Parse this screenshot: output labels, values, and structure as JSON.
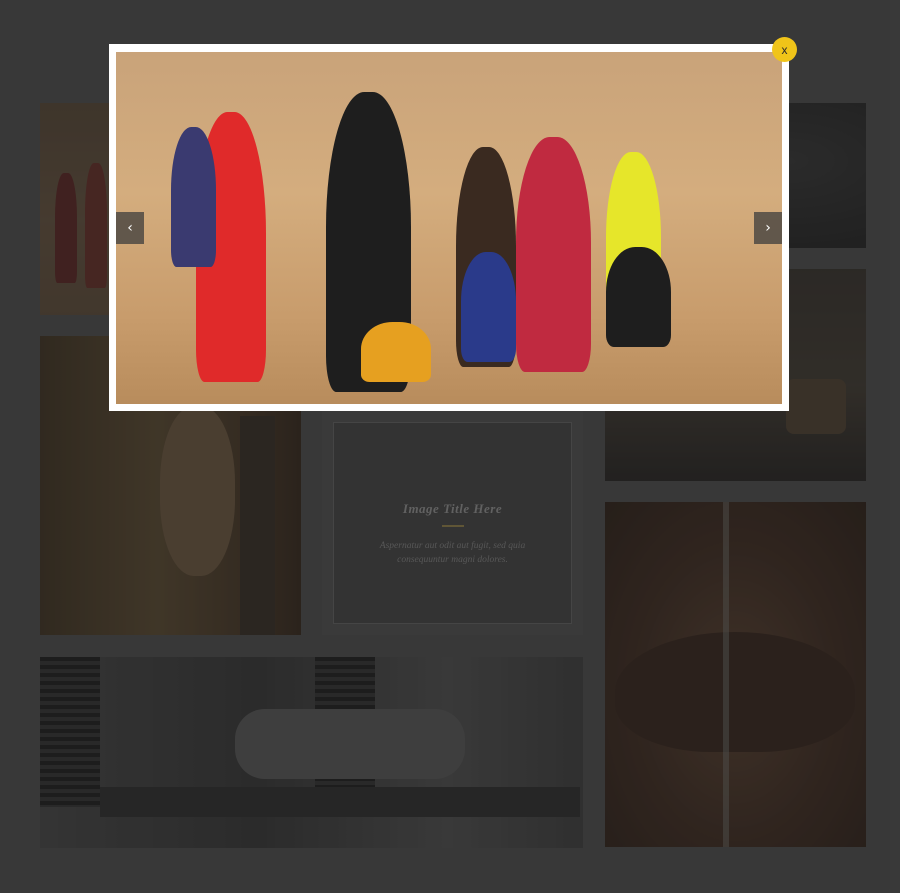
{
  "gallery": {
    "caption_tile": {
      "title": "Image Title Here",
      "description": "Aspernatur aut odit aut fugit, sed quia consequuntur magni dolores."
    }
  },
  "lightbox": {
    "prev_icon": "chevron-left-icon",
    "next_icon": "chevron-right-icon",
    "prev_glyph": "‹",
    "next_glyph": "›",
    "close_label": "x",
    "close_color": "#f0c419"
  }
}
